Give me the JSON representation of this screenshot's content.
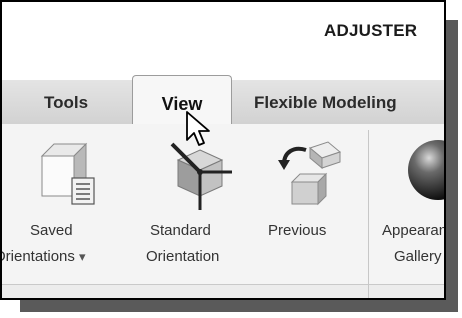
{
  "window": {
    "title": "ADJUSTER"
  },
  "tabs": [
    {
      "label": "Tools"
    },
    {
      "label": "View",
      "active": true
    },
    {
      "label": "Flexible Modeling"
    }
  ],
  "ribbon": {
    "saved": {
      "line1": "Saved",
      "line2": "Orientations",
      "dropdown": "▾",
      "icon": "saved-orientations-icon"
    },
    "standard": {
      "line1": "Standard",
      "line2": "Orientation",
      "icon": "standard-orientation-icon"
    },
    "previous": {
      "line1": "Previous",
      "icon": "previous-orientation-icon"
    },
    "appearance": {
      "line1": "Appearance",
      "line2": "Gallery",
      "icon": "appearance-sphere-icon"
    }
  },
  "colors": {
    "tab_bar": "#d8d8d8",
    "active_tab": "#f7f7f7",
    "ribbon": "#f4f4f4",
    "shadow": "#5a5a5a"
  }
}
